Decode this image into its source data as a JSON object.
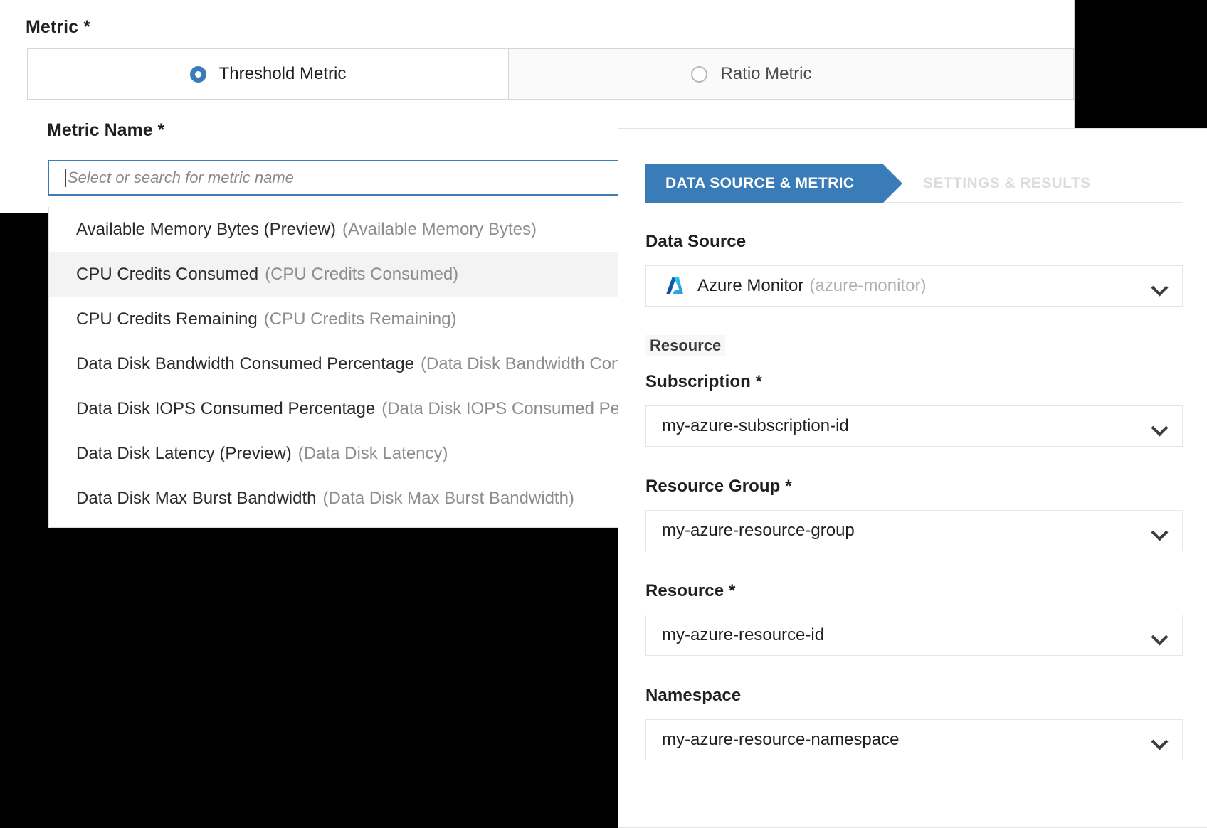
{
  "metric_form": {
    "section_label": "Metric *",
    "tabs": [
      {
        "label": "Threshold Metric",
        "selected": true,
        "radio_icon": "radio-selected-icon"
      },
      {
        "label": "Ratio Metric",
        "selected": false,
        "radio_icon": "radio-unselected-icon"
      }
    ],
    "metric_name_label": "Metric Name *",
    "search": {
      "value": "",
      "placeholder": "Select or search for metric name"
    },
    "dropdown_options": [
      {
        "name": "Available Memory Bytes (Preview)",
        "id": "(Available Memory Bytes)",
        "selected": false
      },
      {
        "name": "CPU Credits Consumed",
        "id": "(CPU Credits Consumed)",
        "selected": true
      },
      {
        "name": "CPU Credits Remaining",
        "id": "(CPU Credits Remaining)",
        "selected": false
      },
      {
        "name": "Data Disk Bandwidth Consumed Percentage",
        "id": "(Data Disk Bandwidth Consumed Percentage)",
        "selected": false
      },
      {
        "name": "Data Disk IOPS Consumed Percentage",
        "id": "(Data Disk IOPS Consumed Percentage)",
        "selected": false
      },
      {
        "name": "Data Disk Latency (Preview)",
        "id": "(Data Disk Latency)",
        "selected": false
      },
      {
        "name": "Data Disk Max Burst Bandwidth",
        "id": "(Data Disk Max Burst Bandwidth)",
        "selected": false
      }
    ]
  },
  "right_panel": {
    "wizard": {
      "active_tab": "DATA SOURCE & METRIC",
      "next_tab": "SETTINGS & RESULTS"
    },
    "data_source": {
      "label": "Data Source",
      "value": "Azure Monitor",
      "value_id": "(azure-monitor)",
      "logo_icon": "azure-monitor-logo-icon",
      "chevron_icon": "chevron-down-icon"
    },
    "resource_section_label": "Resource",
    "fields": [
      {
        "label": "Subscription *",
        "value": "my-azure-subscription-id",
        "chevron_icon": "chevron-down-icon"
      },
      {
        "label": "Resource Group *",
        "value": "my-azure-resource-group",
        "chevron_icon": "chevron-down-icon"
      },
      {
        "label": "Resource *",
        "value": "my-azure-resource-id",
        "chevron_icon": "chevron-down-icon"
      },
      {
        "label": "Namespace",
        "value": "my-azure-resource-namespace",
        "chevron_icon": "chevron-down-icon"
      }
    ]
  },
  "colors": {
    "accent_blue": "#3a7cb8",
    "text_primary": "#1f1f1f",
    "text_muted": "#8d8d8d",
    "panel_background": "#ffffff",
    "page_background": "#000000"
  }
}
